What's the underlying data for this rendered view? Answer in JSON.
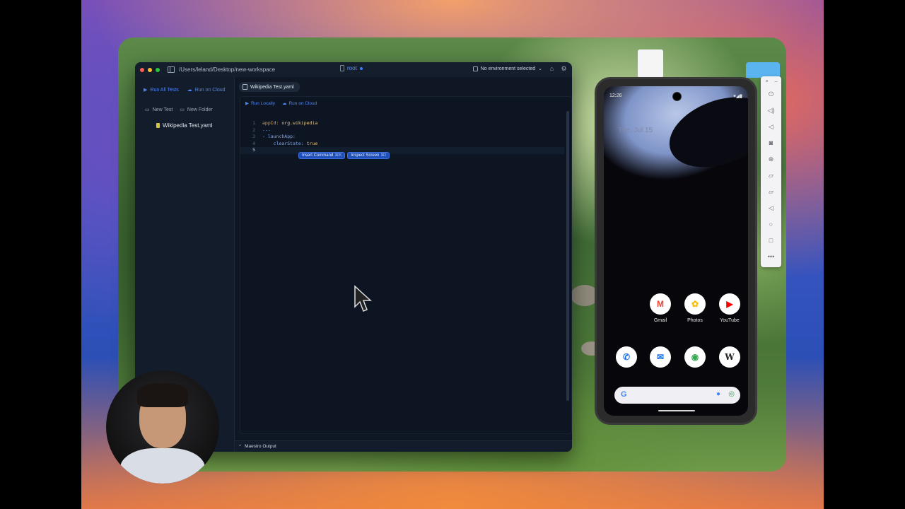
{
  "window": {
    "path": "/Users/leland/Desktop/new-workspace",
    "device": "root",
    "environment": "No environment selected"
  },
  "sidebar": {
    "run_all": "Run All Tests",
    "run_cloud": "Run on Cloud",
    "new_test": "New Test",
    "new_folder": "New Folder",
    "file": "Wikipedia Test.yaml"
  },
  "editor": {
    "tab": "Wikipedia Test.yaml",
    "run_locally": "Run Locally",
    "run_cloud": "Run on Cloud",
    "lines": [
      {
        "n": "1",
        "key": "appId:",
        "val": " org.wikipedia"
      },
      {
        "n": "2",
        "key": "---",
        "val": ""
      },
      {
        "n": "3",
        "key": "- launchApp:",
        "val": ""
      },
      {
        "n": "4",
        "key": "    clearState:",
        "val": " true"
      },
      {
        "n": "5",
        "key": "",
        "val": ""
      }
    ],
    "insert_command": "Insert Command",
    "insert_shortcut": "⌘K",
    "inspect_screen": "Inspect Screen",
    "inspect_shortcut": "⌘I",
    "output_label": "Maestro Output"
  },
  "phone": {
    "time": "12:26",
    "date": "Tue, Jul 15",
    "apps_row1": [
      {
        "label": "Gmail",
        "glyph": "M",
        "color": "#ea4335"
      },
      {
        "label": "Photos",
        "glyph": "✿",
        "color": "#fbbc04"
      },
      {
        "label": "YouTube",
        "glyph": "▶",
        "color": "#ff0000"
      }
    ],
    "apps_row2": [
      {
        "glyph": "✆",
        "color": "#1a73e8"
      },
      {
        "glyph": "✉",
        "color": "#1a73e8"
      },
      {
        "glyph": "◉",
        "color": "#34a853"
      },
      {
        "glyph": "W",
        "color": "#222222"
      }
    ],
    "search_g": "G"
  }
}
